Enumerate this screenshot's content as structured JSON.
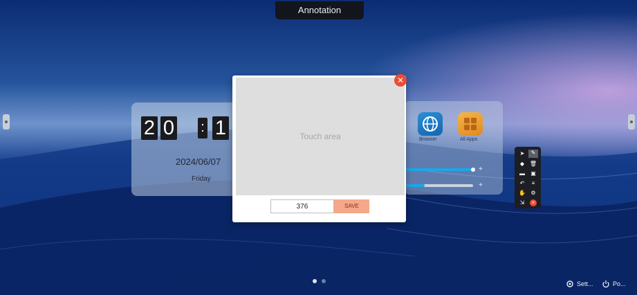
{
  "window": {
    "title": "Annotation"
  },
  "clock": {
    "digits": [
      "2",
      "0",
      "1"
    ],
    "separator": ":",
    "date": "2024/06/07",
    "weekday": "Friday"
  },
  "apps": [
    {
      "label": "Browser",
      "icon": "globe-icon"
    },
    {
      "label": "All Apps",
      "icon": "grid-icon"
    }
  ],
  "dialog": {
    "touch_area_label": "Touch area",
    "value": "376",
    "save_label": "SAVE",
    "close_icon": "close-icon"
  },
  "pager": {
    "pages": 2,
    "active": 1
  },
  "system": {
    "settings_label": "Sett...",
    "power_label": "Po..."
  },
  "colors": {
    "accent": "#ef4a32",
    "save_bg": "#f4a889",
    "slider": "#1aa7e6"
  }
}
